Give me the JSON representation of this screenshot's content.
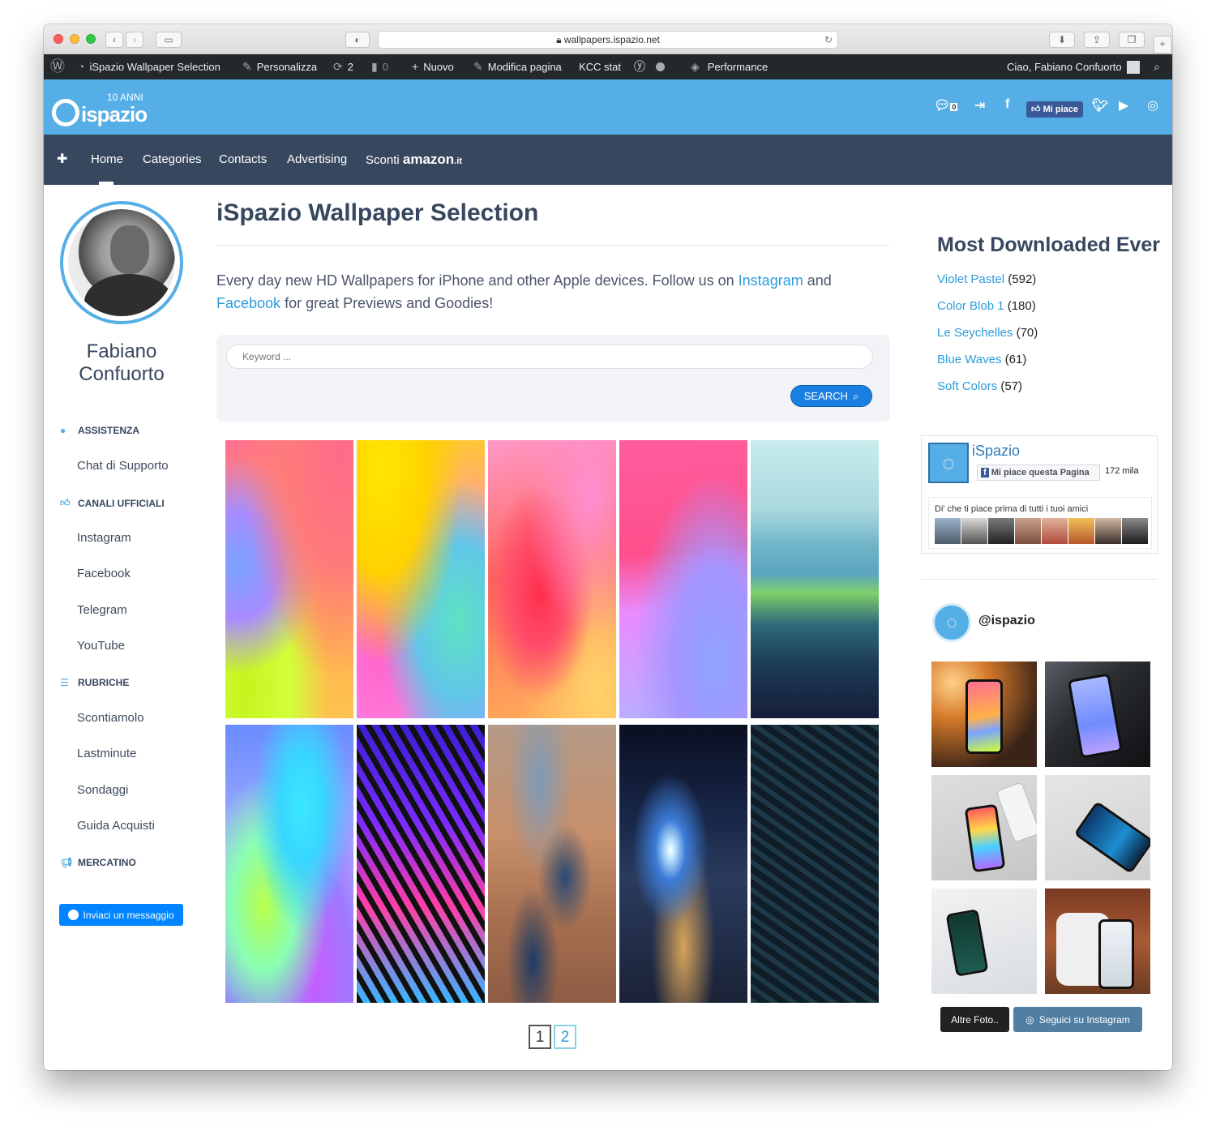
{
  "browser": {
    "url": "wallpapers.ispazio.net",
    "new_tab_symbol": "+"
  },
  "admin_bar": {
    "site_name": "iSpazio Wallpaper Selection",
    "customize": "Personalizza",
    "updates_count": "2",
    "comments_count": "0",
    "new": "Nuovo",
    "edit_page": "Modifica pagina",
    "kcc_stat": "KCC stat",
    "performance": "Performance",
    "greeting": "Ciao, Fabiano Confuorto"
  },
  "header": {
    "logo_text": "ispazio",
    "logo_badge": "10 ANNI",
    "notifications_count": "0",
    "fb_like_label": "Mi piace"
  },
  "nav": {
    "plus": "✚",
    "items": [
      "Home",
      "Categories",
      "Contacts",
      "Advertising"
    ],
    "sconti": "Sconti",
    "amazon": "amazon",
    "amazon_tld": ".it"
  },
  "sidebar": {
    "author_name": "Fabiano Confuorto",
    "sections": [
      {
        "title": "ASSISTENZA",
        "icon": "chat-bubbles-icon",
        "links": [
          "Chat di Supporto"
        ]
      },
      {
        "title": "CANALI UFFICIALI",
        "icon": "thumbs-up-icon",
        "links": [
          "Instagram",
          "Facebook",
          "Telegram",
          "YouTube"
        ]
      },
      {
        "title": "RUBRICHE",
        "icon": "list-icon",
        "links": [
          "Scontiamolo",
          "Lastminute",
          "Sondaggi",
          "Guida Acquisti"
        ]
      },
      {
        "title": "MERCATINO",
        "icon": "megaphone-icon",
        "links": []
      }
    ],
    "message_button": "Inviaci un messaggio"
  },
  "main": {
    "title": "iSpazio Wallpaper Selection",
    "intro_before": "Every day new HD Wallpapers for iPhone and other Apple devices. Follow us on ",
    "intro_link_instagram": "Instagram",
    "intro_and": " and ",
    "intro_link_facebook": "Facebook",
    "intro_after": " for great Previews and Goodies!",
    "search_placeholder": "Keyword ...",
    "search_button": "SEARCH",
    "pages": [
      "1",
      "2"
    ],
    "current_page": "1"
  },
  "right": {
    "most_downloaded_title": "Most Downloaded Ever",
    "most_downloaded": [
      {
        "name": "Violet Pastel",
        "count": "(592)"
      },
      {
        "name": "Color Blob 1",
        "count": "(180)"
      },
      {
        "name": "Le Seychelles",
        "count": "(70)"
      },
      {
        "name": "Blue Waves",
        "count": "(61)"
      },
      {
        "name": "Soft Colors",
        "count": "(57)"
      }
    ],
    "facebook": {
      "page_name": "iSpazio",
      "like_button": "Mi piace questa Pagina",
      "like_count": "172 mila",
      "friends_note": "Di' che ti piace prima di tutti i tuoi amici"
    },
    "instagram": {
      "handle": "@ispazio",
      "more_button": "Altre Foto..",
      "follow_button": "Seguici su Instagram"
    }
  },
  "colors": {
    "header_blue": "#56aee6",
    "nav_dark": "#37475e",
    "admin_bar": "#23282d",
    "link_blue": "#2d9cdb",
    "search_button": "#1a7fe0"
  }
}
